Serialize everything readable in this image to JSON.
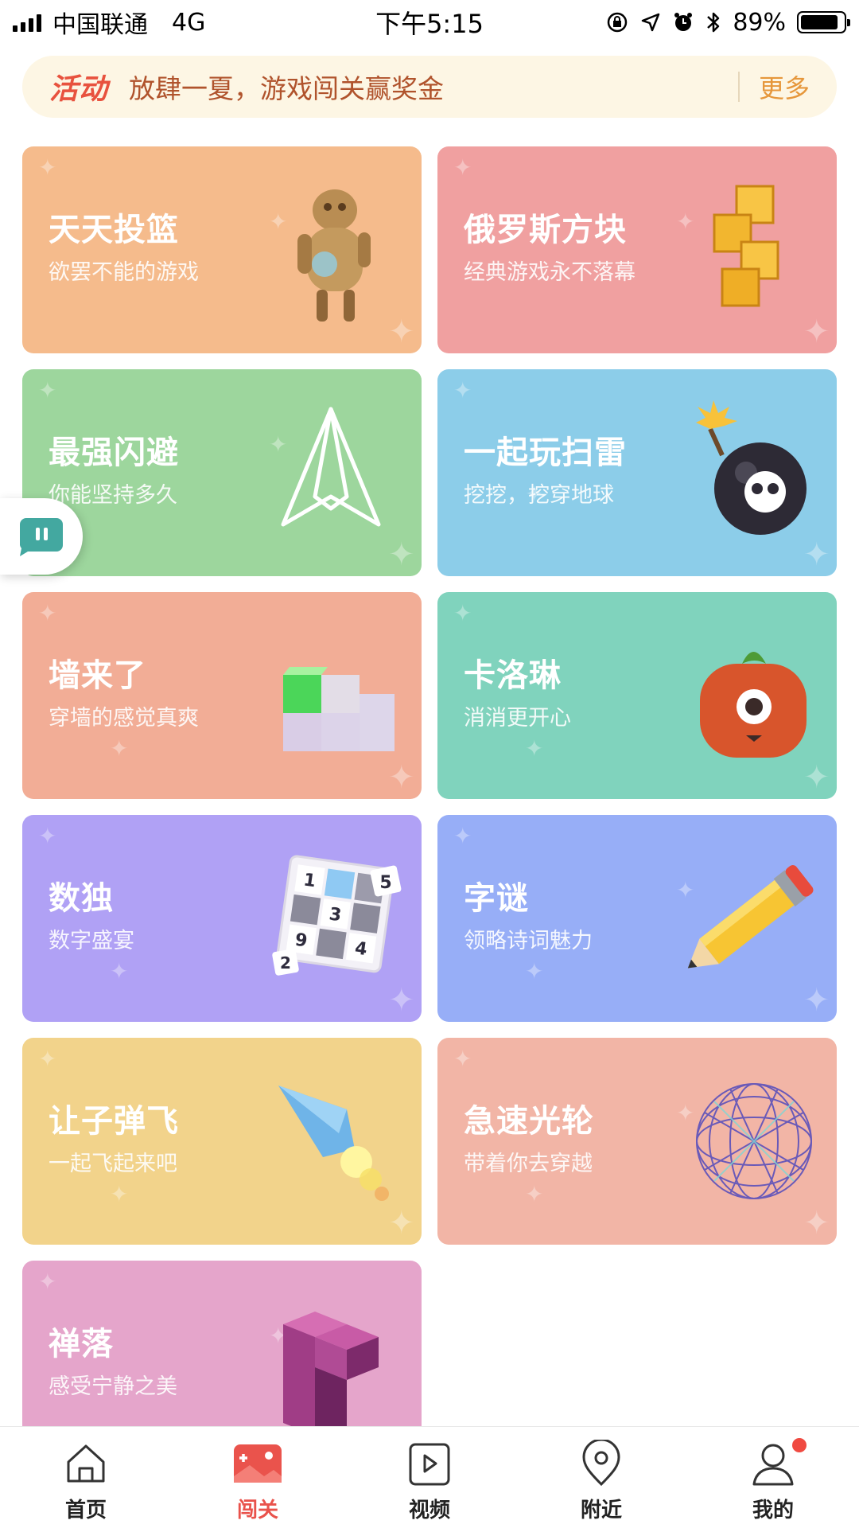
{
  "status": {
    "carrier": "中国联通",
    "network": "4G",
    "time": "下午5:15",
    "battery": "89%",
    "battery_level": 0.89
  },
  "banner": {
    "tag": "活动",
    "text": "放肆一夏，游戏闯关赢奖金",
    "more": "更多"
  },
  "games": [
    {
      "title": "天天投篮",
      "subtitle": "欲罢不能的游戏",
      "color": "#f5bb8c",
      "icon": "robot-icon"
    },
    {
      "title": "俄罗斯方块",
      "subtitle": "经典游戏永不落幕",
      "color": "#f0a0a0",
      "icon": "tetris-block-icon"
    },
    {
      "title": "最强闪避",
      "subtitle": "你能坚持多久",
      "color": "#9dd69d",
      "icon": "paper-plane-icon"
    },
    {
      "title": "一起玩扫雷",
      "subtitle": "挖挖，挖穿地球",
      "color": "#8ccde9",
      "icon": "bomb-icon"
    },
    {
      "title": "墙来了",
      "subtitle": "穿墙的感觉真爽",
      "color": "#f2ad96",
      "icon": "cubes-icon"
    },
    {
      "title": "卡洛琳",
      "subtitle": "消消更开心",
      "color": "#80d3bd",
      "icon": "tomato-monster-icon"
    },
    {
      "title": "数独",
      "subtitle": "数字盛宴",
      "color": "#b0a1f5",
      "icon": "sudoku-icon"
    },
    {
      "title": "字谜",
      "subtitle": "领略诗词魅力",
      "color": "#97aef7",
      "icon": "pencil-icon"
    },
    {
      "title": "让子弹飞",
      "subtitle": "一起飞起来吧",
      "color": "#f2d38b",
      "icon": "bullet-icon"
    },
    {
      "title": "急速光轮",
      "subtitle": "带着你去穿越",
      "color": "#f2b5a6",
      "icon": "wire-sphere-icon"
    },
    {
      "title": "禅落",
      "subtitle": "感受宁静之美",
      "color": "#e5a5cb",
      "icon": "zen-block-icon"
    }
  ],
  "sudoku_numbers": [
    "1",
    "5",
    "3",
    "9",
    "2",
    "4"
  ],
  "tabs": [
    {
      "label": "首页",
      "active": false
    },
    {
      "label": "闯关",
      "active": true
    },
    {
      "label": "视频",
      "active": false
    },
    {
      "label": "附近",
      "active": false
    },
    {
      "label": "我的",
      "active": false
    }
  ]
}
